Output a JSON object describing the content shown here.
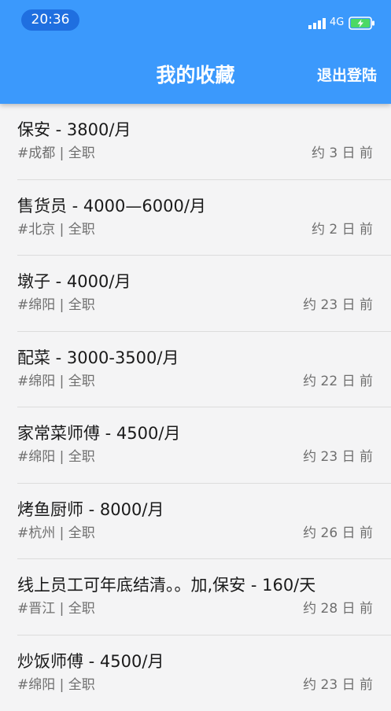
{
  "status_bar": {
    "time": "20:36",
    "network": "4G"
  },
  "header": {
    "title": "我的收藏",
    "logout_label": "退出登陆"
  },
  "jobs": [
    {
      "title": "保安 - 3800/月",
      "meta": "#成都 | 全职",
      "time": "约 3 日 前"
    },
    {
      "title": "售货员 - 4000—6000/月",
      "meta": "#北京 | 全职",
      "time": "约 2 日 前"
    },
    {
      "title": "墩子 - 4000/月",
      "meta": "#绵阳 | 全职",
      "time": "约 23 日 前"
    },
    {
      "title": "配菜 - 3000-3500/月",
      "meta": "#绵阳 | 全职",
      "time": "约 22 日 前"
    },
    {
      "title": "家常菜师傅 - 4500/月",
      "meta": "#绵阳 | 全职",
      "time": "约 23 日 前"
    },
    {
      "title": "烤鱼厨师 - 8000/月",
      "meta": "#杭州 | 全职",
      "time": "约 26 日 前"
    },
    {
      "title": "线上员工可年底结清。。加,保安 - 160/天",
      "meta": "#晋江 | 全职",
      "time": "约 28 日 前"
    },
    {
      "title": "炒饭师傅 - 4500/月",
      "meta": "#绵阳 | 全职",
      "time": "约 23 日 前"
    }
  ],
  "colors": {
    "app_bar": "#3b99fc",
    "time_pill": "#1f6fe0",
    "background": "#f4f4f5",
    "battery_fill": "#4cd964"
  }
}
